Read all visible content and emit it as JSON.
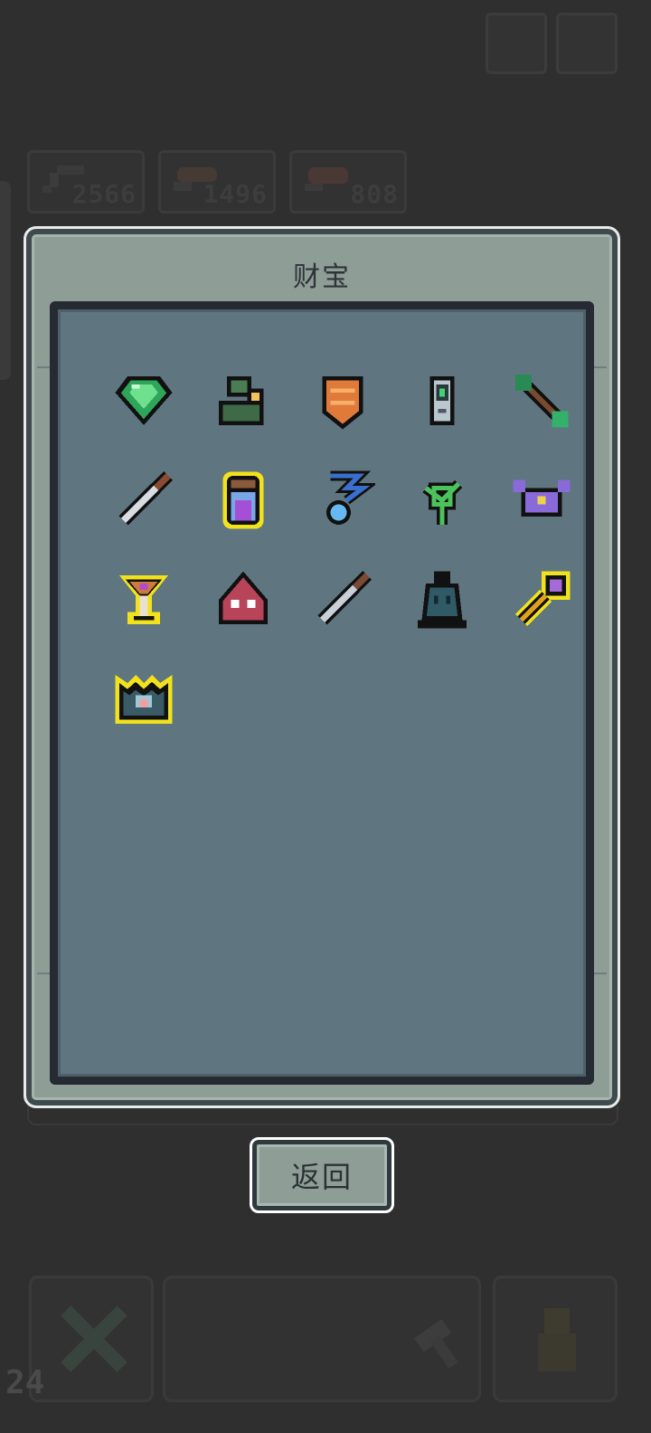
{
  "hud": {
    "resources": [
      {
        "icon": "sword-icon",
        "count": "2566"
      },
      {
        "icon": "bread-icon",
        "count": "1496"
      },
      {
        "icon": "meat-icon",
        "count": "808"
      }
    ],
    "level": "24"
  },
  "modal": {
    "title": "财宝",
    "return_label": "返回"
  },
  "treasures": [
    {
      "icon": "emerald-gem-icon",
      "highlighted": false
    },
    {
      "icon": "green-statue-icon",
      "highlighted": false
    },
    {
      "icon": "orange-chestplate-icon",
      "highlighted": false
    },
    {
      "icon": "handheld-device-icon",
      "highlighted": false
    },
    {
      "icon": "green-arrow-icon",
      "highlighted": false
    },
    {
      "icon": "steel-dagger-icon",
      "highlighted": false
    },
    {
      "icon": "purple-potion-jar-icon",
      "highlighted": true
    },
    {
      "icon": "blue-spirit-icon",
      "highlighted": false
    },
    {
      "icon": "green-vine-icon",
      "highlighted": false
    },
    {
      "icon": "purple-crab-icon",
      "highlighted": false
    },
    {
      "icon": "golden-chalice-icon",
      "highlighted": true
    },
    {
      "icon": "red-mask-icon",
      "highlighted": false
    },
    {
      "icon": "iron-knife-icon",
      "highlighted": false
    },
    {
      "icon": "dark-bell-icon",
      "highlighted": false
    },
    {
      "icon": "purple-scepter-icon",
      "highlighted": true
    },
    {
      "icon": "crystal-crown-icon",
      "highlighted": true
    }
  ]
}
